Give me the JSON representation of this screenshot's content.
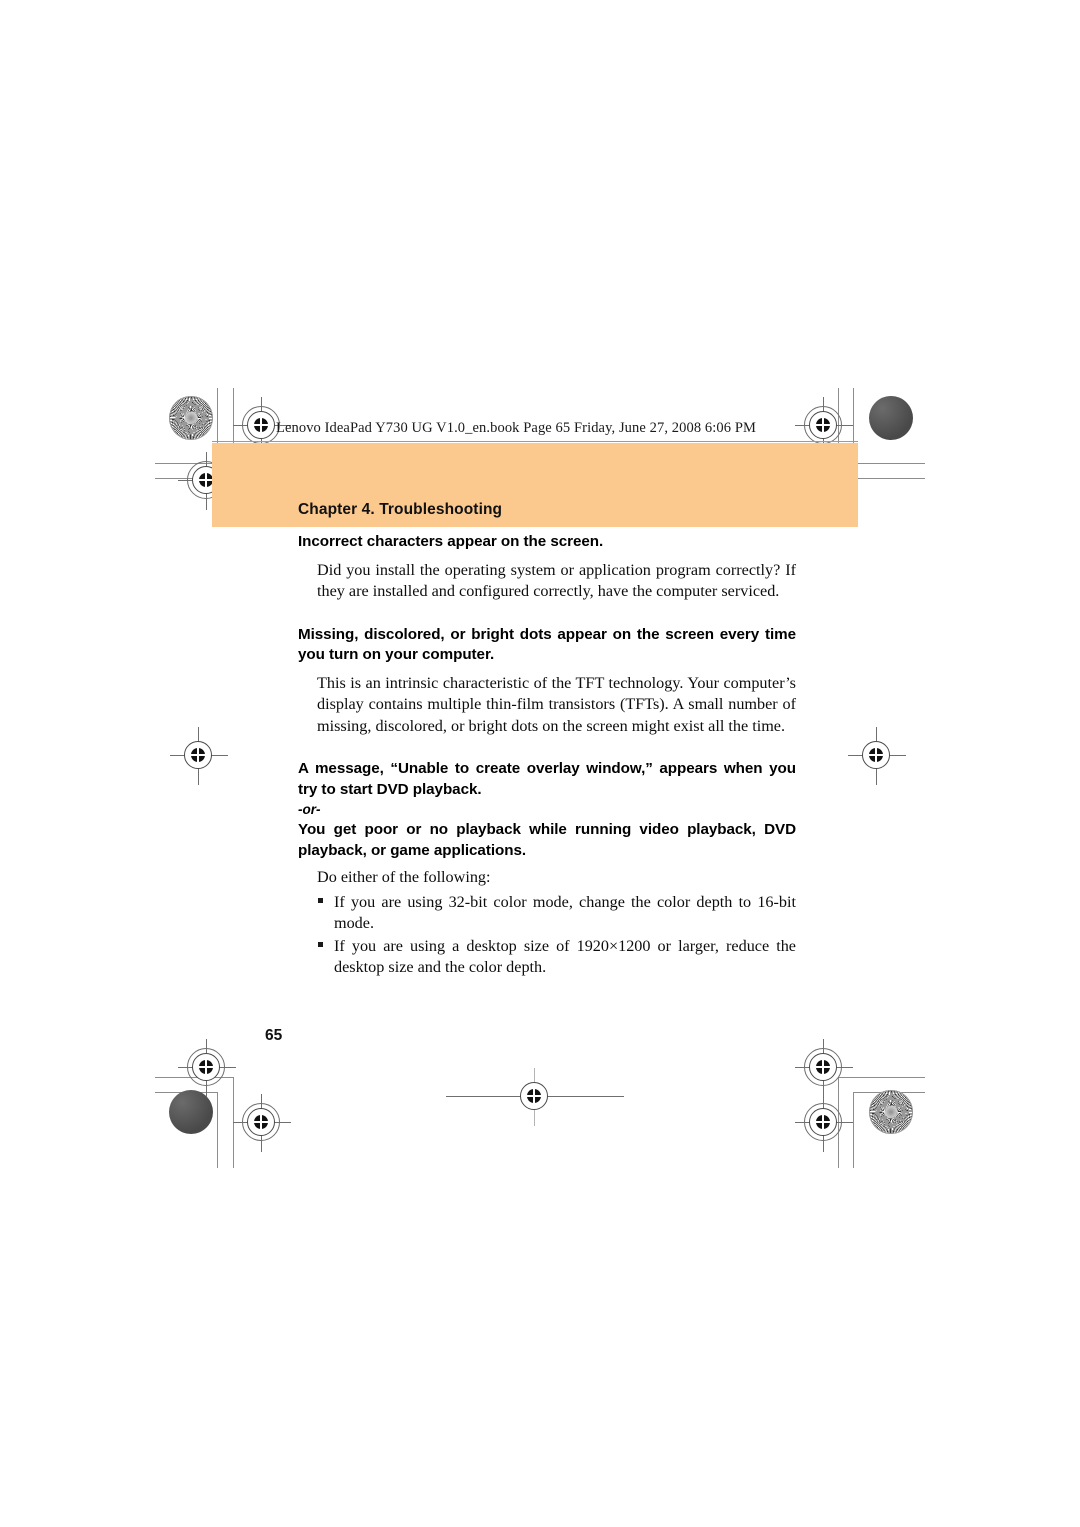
{
  "document": {
    "file_info": "Lenovo IdeaPad Y730 UG V1.0_en.book  Page 65  Friday, June 27, 2008  6:06 PM",
    "chapter_title": "Chapter 4. Troubleshooting",
    "page_number": "65",
    "band_color": "#fbc98e"
  },
  "content": {
    "sections": [
      {
        "heading": "Incorrect characters appear on the screen.",
        "paragraph": "Did you install the operating system or application program correctly? If they are installed and configured correctly, have the computer serviced."
      },
      {
        "heading": "Missing, discolored, or bright dots appear on the screen every time you turn on your computer.",
        "paragraph": "This is an intrinsic characteristic of the TFT technology. Your computer’s display contains multiple thin-film transistors (TFTs). A small number of missing, discolored, or bright dots on the screen might exist all the time."
      },
      {
        "heading": "A message, “Unable to create overlay window,” appears when you try to start DVD playback.",
        "or_label": "-or-",
        "heading2": "You get poor or no playback while running video playback, DVD playback, or game applications.",
        "paragraph": "Do either of the following:",
        "bullets": [
          "If you are using 32-bit color mode, change the color depth to 16-bit mode.",
          "If you are using a desktop size of 1920×1200 or larger, reduce the desktop size and the color depth."
        ]
      }
    ]
  },
  "print_marks": {
    "top_left_patch": "starburst-density-patch",
    "top_right_patch": "solid-density-patch",
    "bottom_left_patch": "solid-density-patch",
    "bottom_right_patch": "starburst-density-patch"
  }
}
